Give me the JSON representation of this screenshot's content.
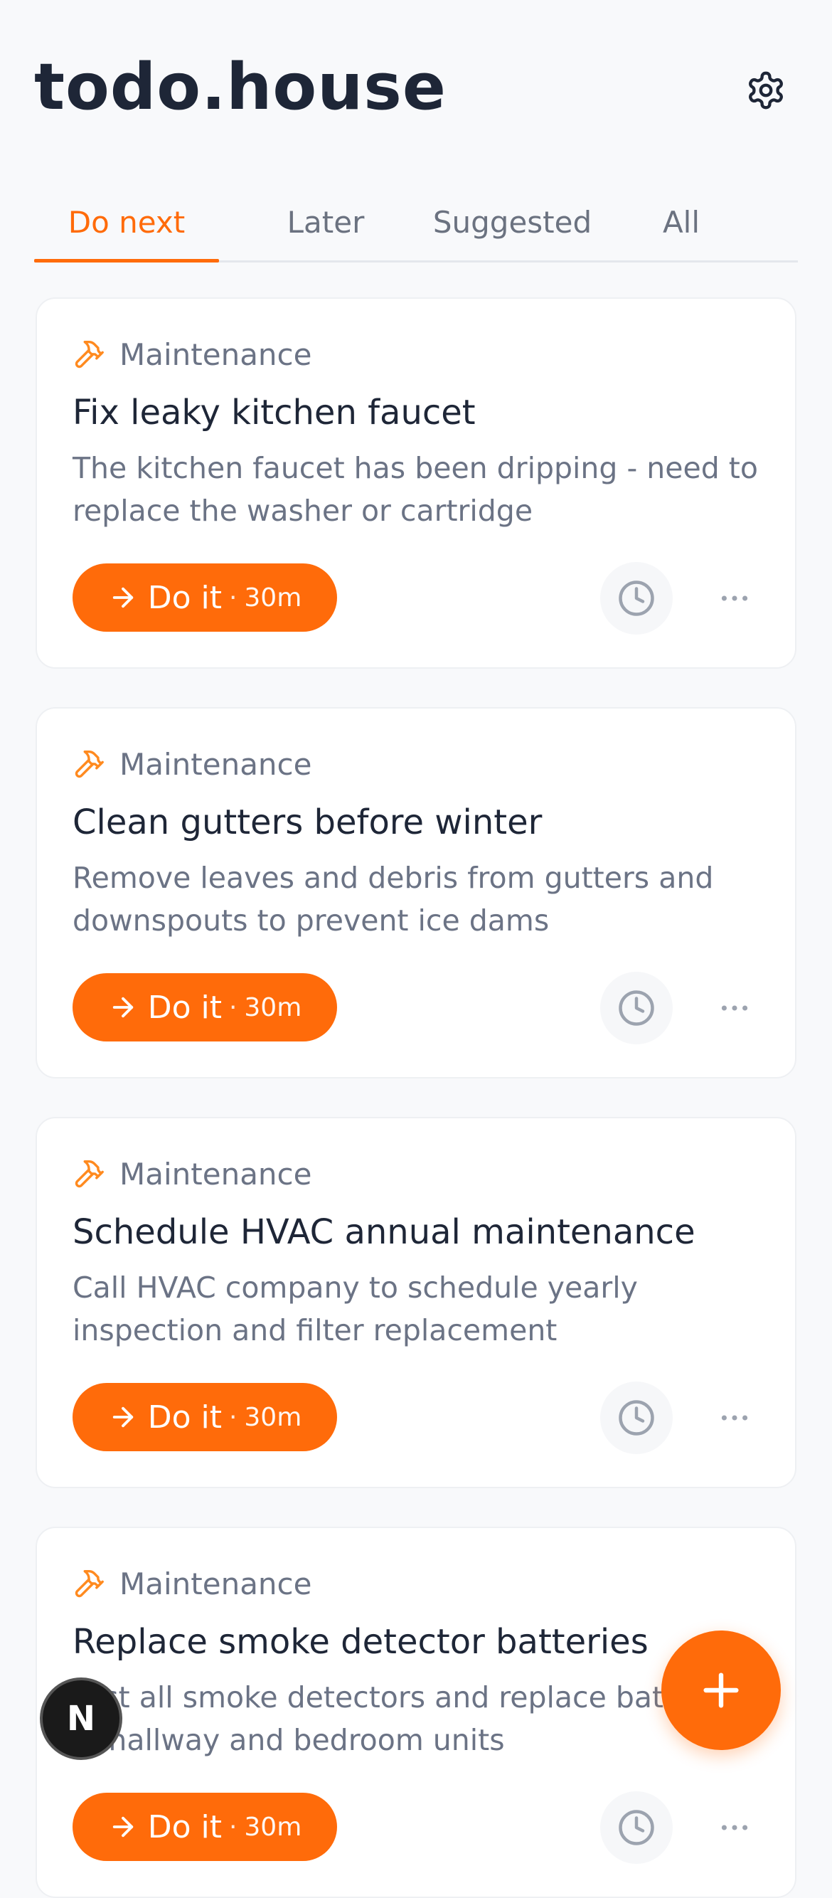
{
  "app": {
    "title": "todo.house"
  },
  "tabs": [
    {
      "label": "Do next",
      "active": true
    },
    {
      "label": "Later",
      "active": false
    },
    {
      "label": "Suggested",
      "active": false
    },
    {
      "label": "All",
      "active": false
    }
  ],
  "tasks": [
    {
      "category": "Maintenance",
      "title": "Fix leaky kitchen faucet",
      "description": "The kitchen faucet has been dripping - need to replace the washer or cartridge",
      "action_label": "Do it",
      "separator": "·",
      "duration": "30m"
    },
    {
      "category": "Maintenance",
      "title": "Clean gutters before winter",
      "description": "Remove leaves and debris from gutters and downspouts to prevent ice dams",
      "action_label": "Do it",
      "separator": "·",
      "duration": "30m"
    },
    {
      "category": "Maintenance",
      "title": "Schedule HVAC annual maintenance",
      "description": "Call HVAC company to schedule yearly inspection and filter replacement",
      "action_label": "Do it",
      "separator": "·",
      "duration": "30m"
    },
    {
      "category": "Maintenance",
      "title": "Replace smoke detector batteries",
      "description": "Test all smoke detectors and replace batteries in hallway and bedroom units",
      "action_label": "Do it",
      "separator": "·",
      "duration": "30m"
    }
  ],
  "dev_badge": {
    "label": "N"
  },
  "icons": {
    "settings": "gear-icon",
    "category": "hammer-icon",
    "do_it": "arrow-right-icon",
    "snooze": "clock-icon",
    "more": "more-horizontal-icon",
    "fab": "plus-icon"
  },
  "colors": {
    "accent": "#ff6b0a",
    "title_text": "#1e2637",
    "muted_text": "#6b7385",
    "background": "#f8f9fb"
  }
}
